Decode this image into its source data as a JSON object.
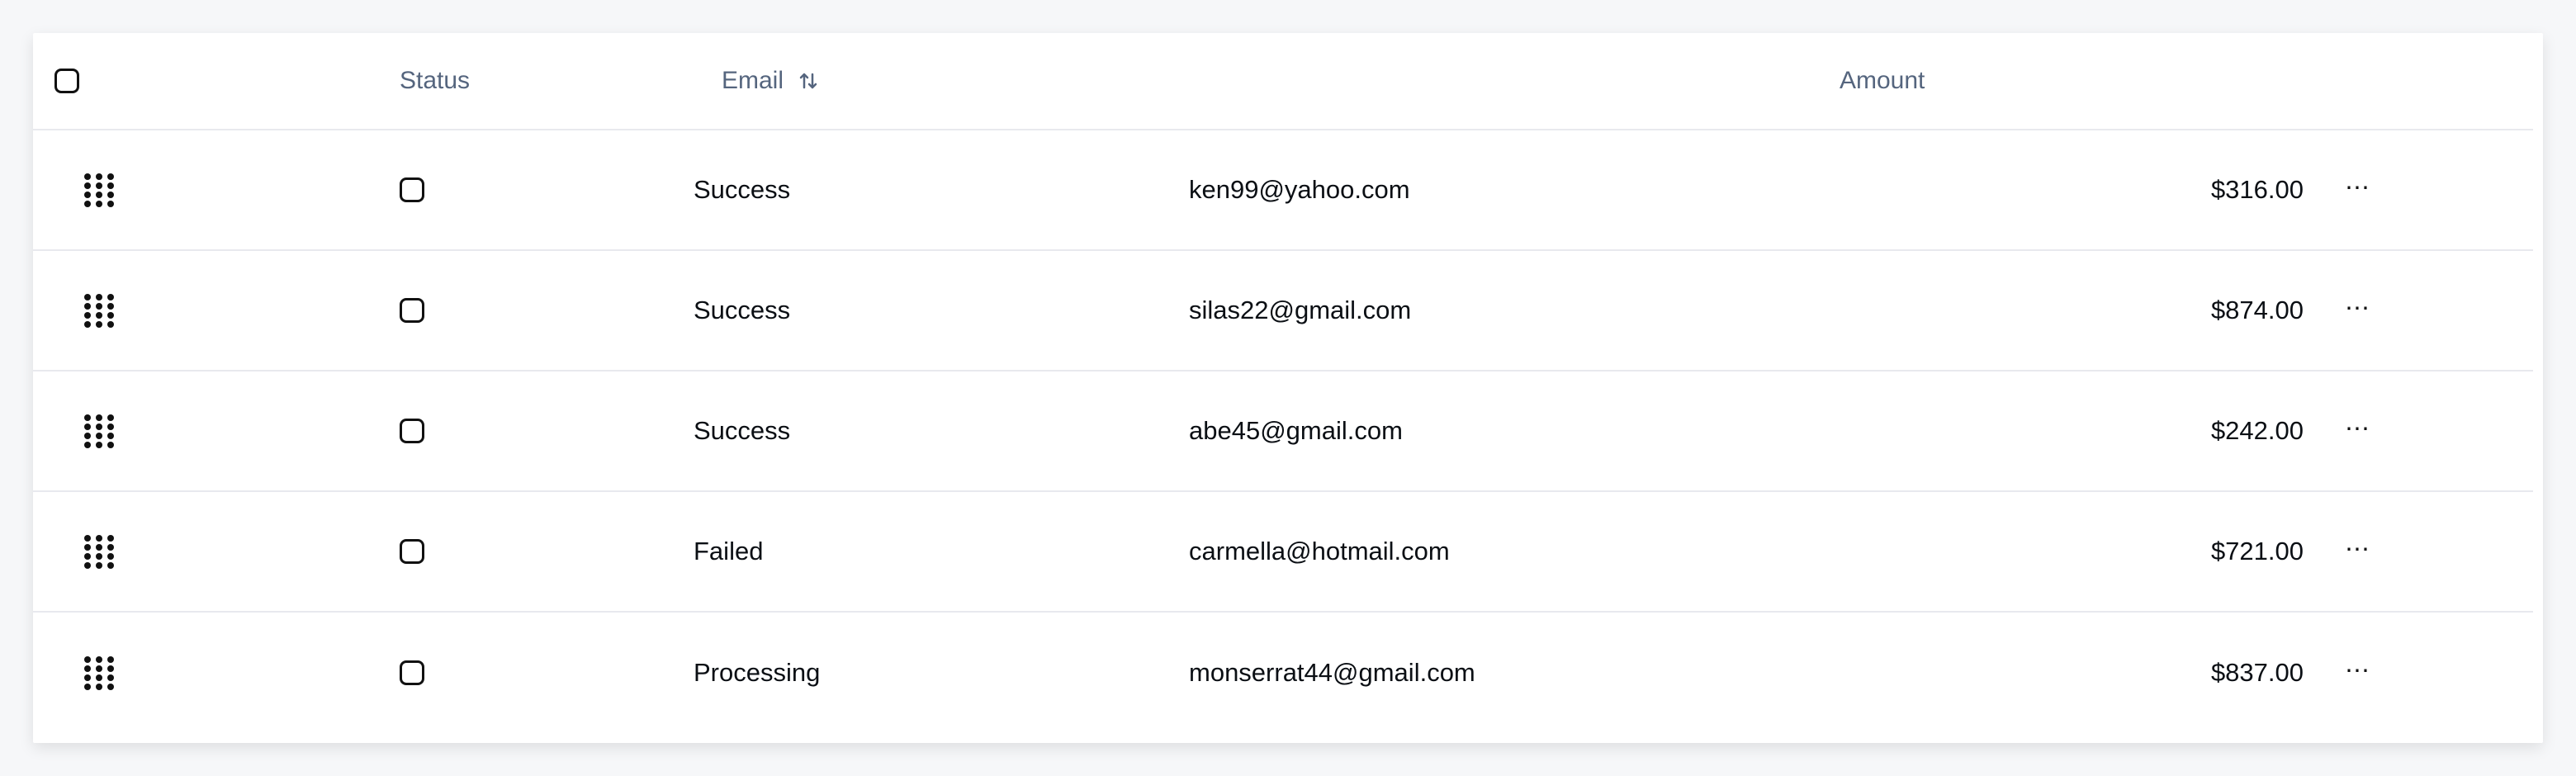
{
  "table": {
    "headers": {
      "status": "Status",
      "email": "Email",
      "amount": "Amount"
    },
    "rows": [
      {
        "status": "Success",
        "email": "ken99@yahoo.com",
        "amount": "$316.00"
      },
      {
        "status": "Success",
        "email": "silas22@gmail.com",
        "amount": "$874.00"
      },
      {
        "status": "Success",
        "email": "abe45@gmail.com",
        "amount": "$242.00"
      },
      {
        "status": "Failed",
        "email": "carmella@hotmail.com",
        "amount": "$721.00"
      },
      {
        "status": "Processing",
        "email": "monserrat44@gmail.com",
        "amount": "$837.00"
      }
    ]
  },
  "icons": {
    "select_all": "checkbox-icon",
    "sort": "sort-arrows-icon",
    "drag": "drag-handle-icon",
    "row_checkbox": "checkbox-icon",
    "row_menu": "more-horizontal-icon"
  }
}
